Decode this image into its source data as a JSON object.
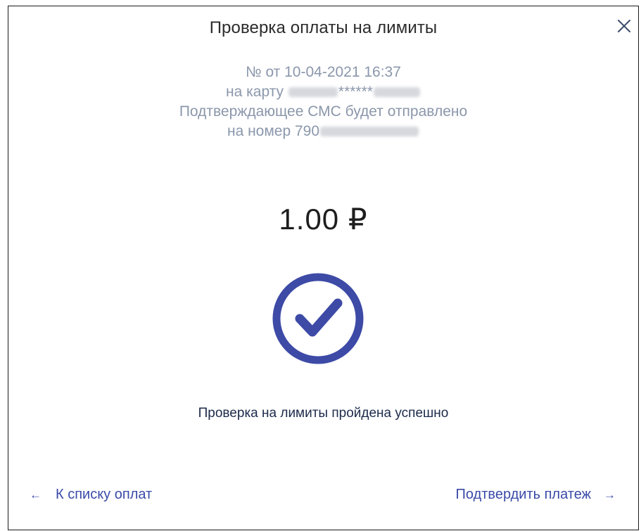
{
  "dialog": {
    "title": "Проверка оплаты на лимиты",
    "close_icon": "close-icon"
  },
  "info": {
    "order_line": "№ от 10-04-2021 16:37",
    "card_prefix": "на карту",
    "card_mask": "******",
    "sms_line": "Подтверждающее СМС будет отправлено",
    "phone_prefix": "на номер 790"
  },
  "amount": {
    "value": "1.00 ₽"
  },
  "status": {
    "icon": "check-circle-icon",
    "text": "Проверка на лимиты пройдена успешно"
  },
  "footer": {
    "back_arrow": "←",
    "back_label": "К списку оплат",
    "next_label": "Подтвердить платеж",
    "next_arrow": "→"
  },
  "colors": {
    "accent": "#3a4aa8",
    "check": "#3d4aa6",
    "info_text": "#8b97ab"
  }
}
